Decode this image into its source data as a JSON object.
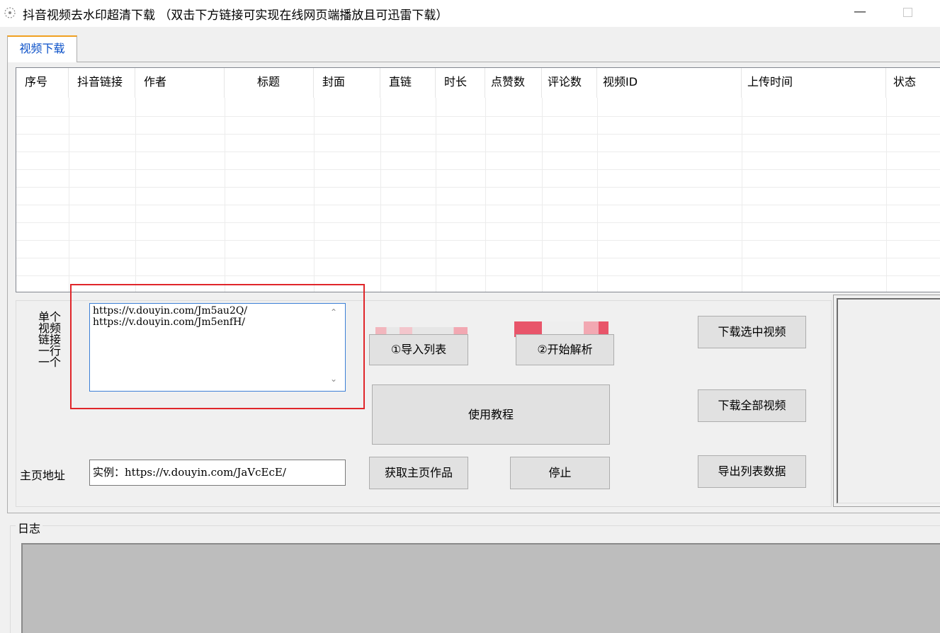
{
  "window": {
    "title": "抖音视频去水印超清下载 （双击下方链接可实现在线网页端播放且可迅雷下载）",
    "minimize_glyph": "—",
    "app_icon": "app-icon"
  },
  "tabs": [
    {
      "label": "视频下载",
      "active": true
    }
  ],
  "table": {
    "columns": [
      "序号",
      "抖音链接",
      "作者",
      "标题",
      "封面",
      "直链",
      "时长",
      "点赞数",
      "评论数",
      "视频ID",
      "上传时间",
      "状态"
    ],
    "rows": []
  },
  "inputs": {
    "single_link_label": [
      "单",
      "个",
      "视",
      "频",
      "链",
      "接",
      "一",
      "行",
      "一",
      "个"
    ],
    "links_value": "https://v.douyin.com/Jm5au2Q/\nhttps://v.douyin.com/Jm5enfH/",
    "homepage_label": "主页地址",
    "homepage_value": "实例：https://v.douyin.com/JaVcEcE/"
  },
  "buttons": {
    "import": "①导入列表",
    "parse": "②开始解析",
    "tutorial": "使用教程",
    "fetch_home": "获取主页作品",
    "stop": "停止",
    "download_selected": "下载选中视频",
    "download_all": "下载全部视频",
    "export": "导出列表数据"
  },
  "log": {
    "label": "日志"
  },
  "colors": {
    "highlight": "#e0262a",
    "active_tab_text": "#0a50c8",
    "active_tab_accent": "#f0a020",
    "blur_marks": "#e8556a"
  }
}
